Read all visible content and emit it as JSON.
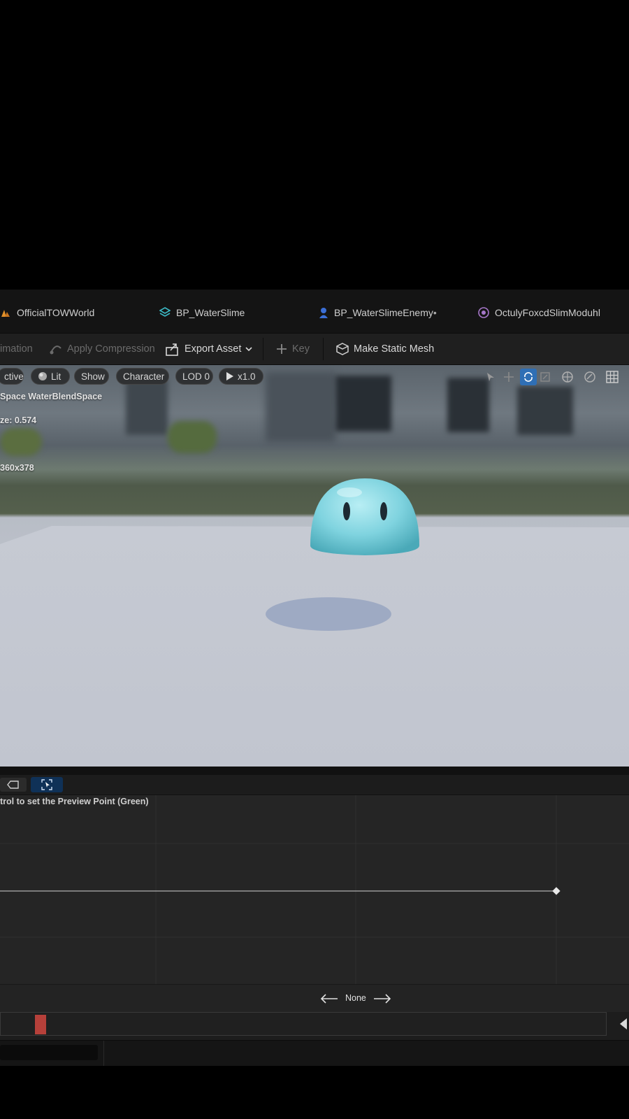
{
  "tabs": [
    {
      "label": "OfficialTOWWorld",
      "icon": "level-icon"
    },
    {
      "label": "BP_WaterSlime",
      "icon": "blueprint-icon"
    },
    {
      "label": "BP_WaterSlimeEnemy",
      "icon": "character-icon",
      "modified_marker": "•"
    },
    {
      "label": "OctulyFoxcdSlimModuhl",
      "icon": "physics-asset-icon"
    }
  ],
  "toolbar": {
    "animation_label": "imation",
    "apply_compression_label": "Apply Compression",
    "export_asset_label": "Export Asset",
    "key_label": "Key",
    "make_static_mesh_label": "Make Static Mesh"
  },
  "viewport": {
    "perspective_label": "ctive",
    "lit_label": "Lit",
    "show_label": "Show",
    "character_label": "Character",
    "lod_label": "LOD 0",
    "speed_label": "x1.0",
    "info_blendspace": "Space WaterBlendSpace",
    "info_size": "ze: 0.574",
    "info_resolution": "360x378"
  },
  "blend_space": {
    "hint_text": "trol to set the Preview Point (Green)",
    "axis_label": "None",
    "sample_value": 1.0
  },
  "timeline": {
    "scrub_position": 0.06
  },
  "colors": {
    "accent_blue": "#2f6fb5",
    "slime": "#7fd3df",
    "scrubber": "#b6403a"
  }
}
